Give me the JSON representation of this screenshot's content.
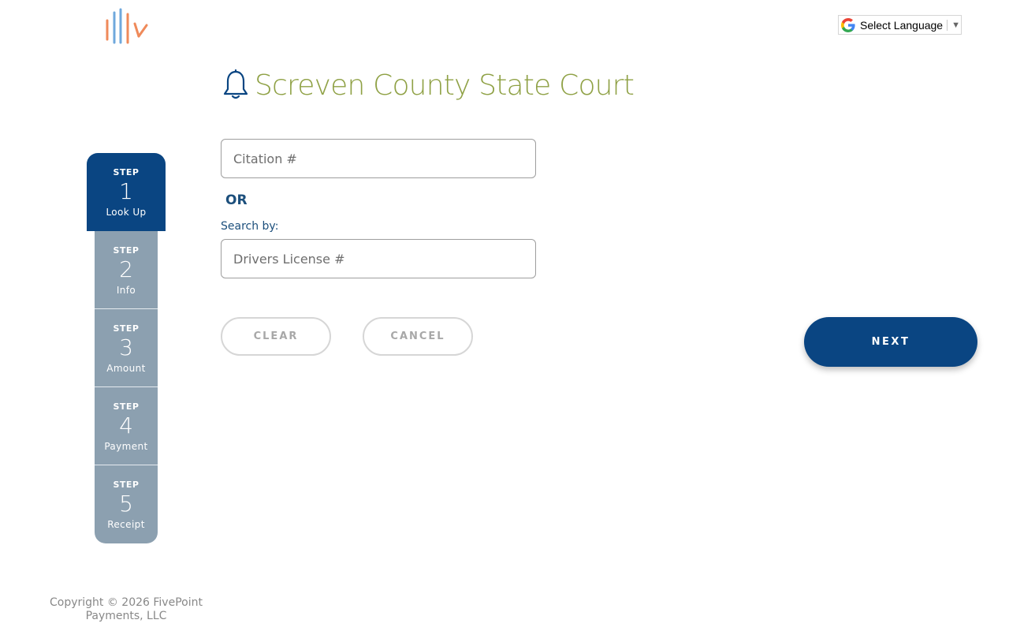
{
  "logo": {
    "icon": "fivepoint-logo-icon",
    "colors": {
      "blue": "#6fa8dc",
      "orange": "#ef8a5a"
    }
  },
  "language": {
    "label": "Select Language",
    "caret": "▼",
    "icon": "google-icon"
  },
  "header": {
    "title": "Screven County State Court",
    "icon": "bell-icon"
  },
  "stepper": {
    "steps": [
      {
        "label": "STEP",
        "number": "1",
        "name": "Look Up",
        "active": true
      },
      {
        "label": "STEP",
        "number": "2",
        "name": "Info",
        "active": false
      },
      {
        "label": "STEP",
        "number": "3",
        "name": "Amount",
        "active": false
      },
      {
        "label": "STEP",
        "number": "4",
        "name": "Payment",
        "active": false
      },
      {
        "label": "STEP",
        "number": "5",
        "name": "Receipt",
        "active": false
      }
    ]
  },
  "form": {
    "citation_placeholder": "Citation #",
    "citation_value": "",
    "or_text": "OR",
    "search_by_label": "Search by:",
    "license_placeholder": "Drivers License #",
    "license_value": ""
  },
  "buttons": {
    "clear": "CLEAR",
    "cancel": "CANCEL",
    "next": "NEXT"
  },
  "footer": {
    "copyright_line1": "Copyright © 2026 FivePoint",
    "copyright_line2": "Payments, LLC"
  },
  "colors": {
    "primary": "#0a4582",
    "title": "#8fa145",
    "step_inactive": "#8ca0b0",
    "label": "#1c4f7c"
  }
}
